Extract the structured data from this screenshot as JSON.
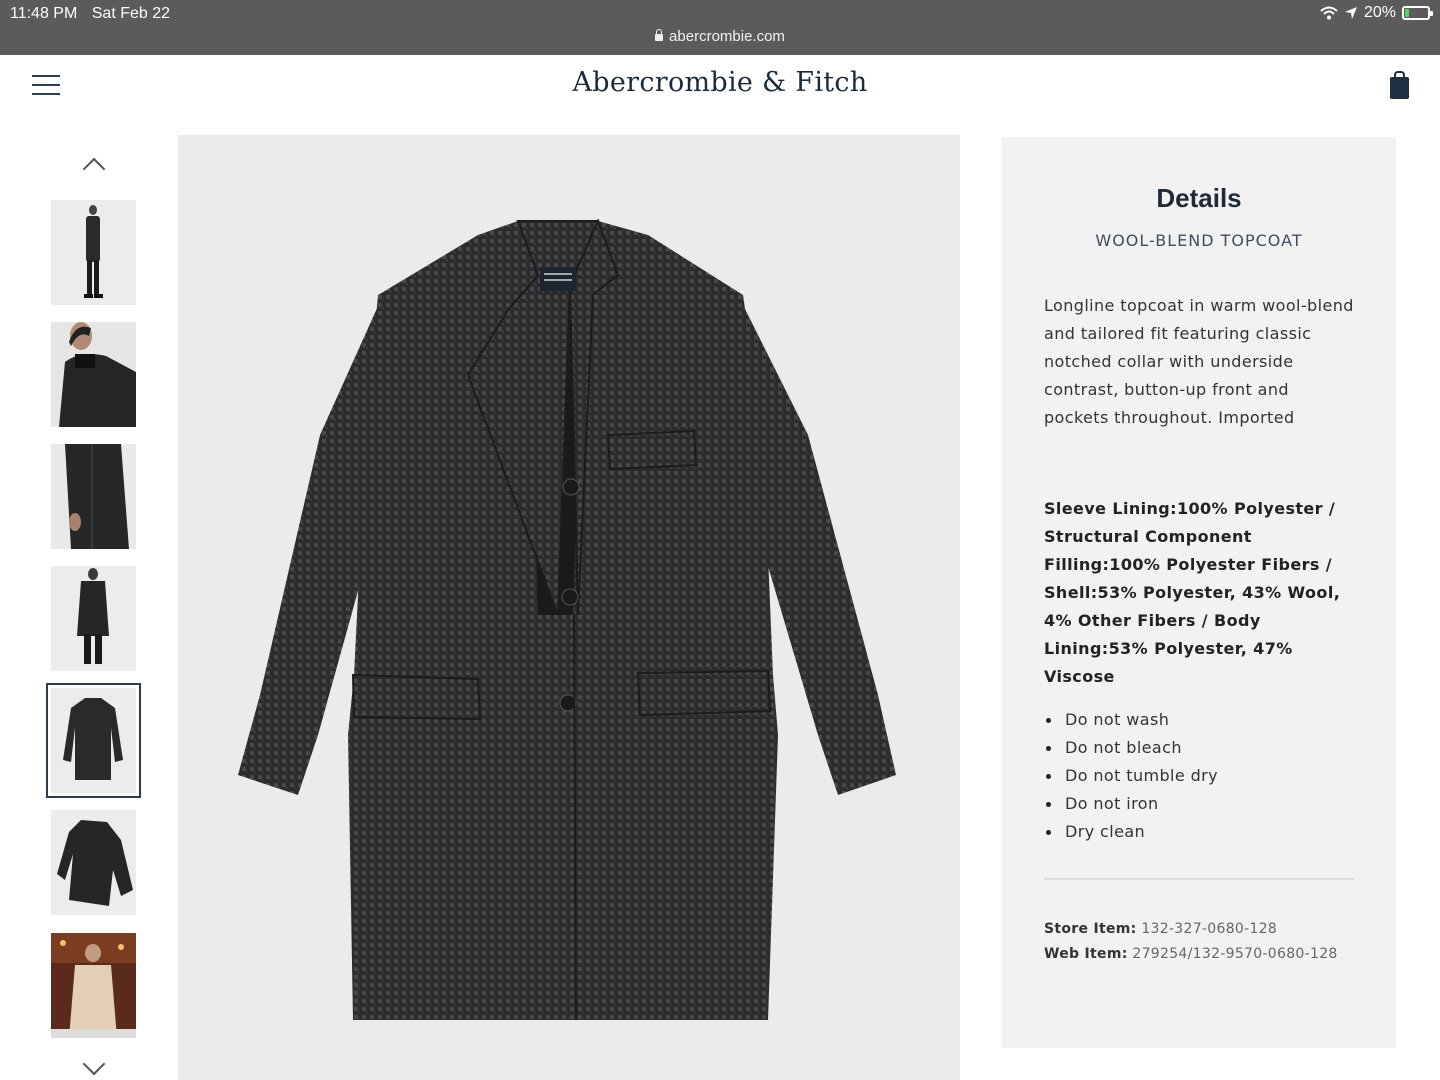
{
  "status_bar": {
    "time": "11:48 PM",
    "date": "Sat Feb 22",
    "battery": "20%",
    "battery_level": 0.2,
    "url": "abercrombie.com"
  },
  "header": {
    "logo": "Abercrombie & Fitch",
    "menu_icon": "hamburger-icon",
    "bag_icon": "shopping-bag-icon"
  },
  "gallery": {
    "thumbnail_count": 7,
    "selected_index": 4,
    "up_icon": "chevron-up-icon",
    "down_icon": "chevron-down-icon"
  },
  "details": {
    "title": "Details",
    "product_name": "WOOL-BLEND TOPCOAT",
    "description": "Longline topcoat in warm wool-blend and tailored fit featuring classic notched collar with underside contrast, button-up front and pockets throughout. Imported",
    "fabric": "Sleeve Lining:100% Polyester / Structural Component Filling:100% Polyester Fibers / Shell:53% Polyester, 43% Wool, 4% Other Fibers / Body Lining:53% Polyester, 47% Viscose",
    "care": [
      "Do not wash",
      "Do not bleach",
      "Do not tumble dry",
      "Do not iron",
      "Dry clean"
    ],
    "store_item_label": "Store Item:",
    "store_item": "132-327-0680-128",
    "web_item_label": "Web Item:",
    "web_item": "279254/132-9570-0680-128"
  },
  "colors": {
    "status_bar": "#5b5b5b",
    "brand_navy": "#1c2b3a",
    "panel_bg": "#f2f2f2",
    "coat": "#2b2b2d"
  }
}
